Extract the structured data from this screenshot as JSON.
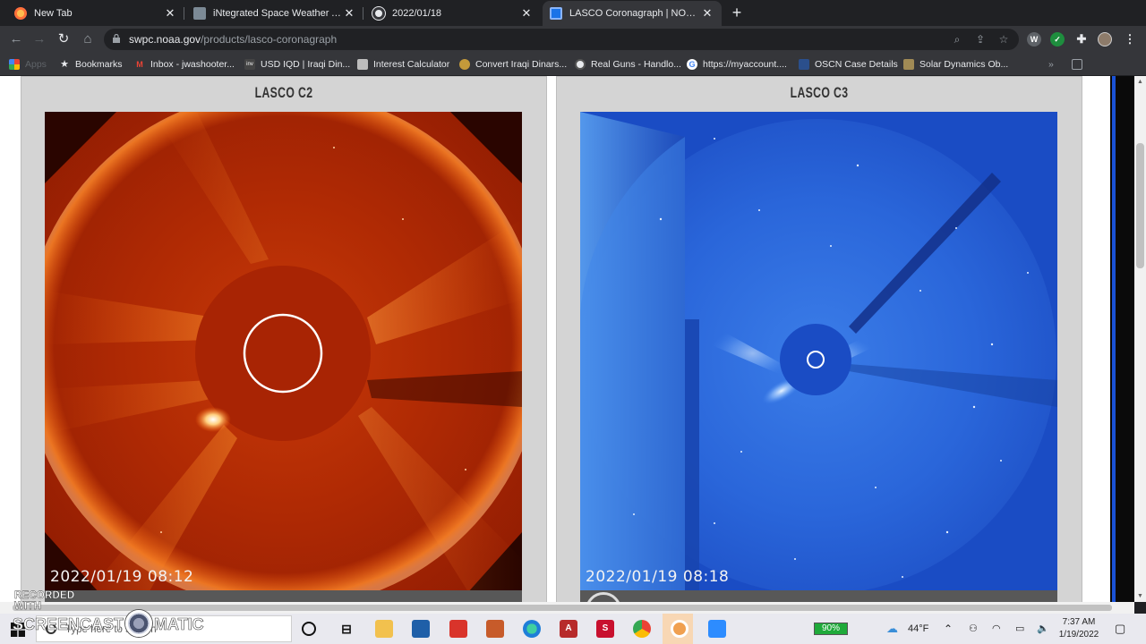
{
  "tabs": [
    {
      "label": "New Tab",
      "favicon": "firefox-icon",
      "active": false
    },
    {
      "label": "iNtegrated Space Weather Analy",
      "favicon": "satellite-icon",
      "active": false
    },
    {
      "label": "2022/01/18",
      "favicon": "globe-icon",
      "active": false
    },
    {
      "label": "LASCO Coronagraph | NOAA / NW",
      "favicon": "noaa-icon",
      "active": true
    }
  ],
  "toolbar": {
    "url_host": "swpc.noaa.gov",
    "url_path": "/products/lasco-coronagraph"
  },
  "bookmarks": {
    "apps_label": "Apps",
    "items": [
      {
        "label": "Bookmarks",
        "icon": "star-icon"
      },
      {
        "label": "Inbox - jwashooter...",
        "icon": "gmail-icon"
      },
      {
        "label": "USD IQD | Iraqi Din...",
        "icon": "inv-icon"
      },
      {
        "label": "Interest Calculator",
        "icon": "calculator-icon"
      },
      {
        "label": "Convert Iraqi Dinars...",
        "icon": "currency-icon"
      },
      {
        "label": "Real Guns - Handlo...",
        "icon": "target-icon"
      },
      {
        "label": "https://myaccount....",
        "icon": "google-icon"
      },
      {
        "label": "OSCN Case Details",
        "icon": "shield-icon"
      },
      {
        "label": "Solar Dynamics Ob...",
        "icon": "sdo-icon"
      }
    ]
  },
  "page": {
    "panels": [
      {
        "title": "LASCO C2",
        "timestamp": "2022/01/19 08:12"
      },
      {
        "title": "LASCO C3",
        "timestamp": "2022/01/19 08:18"
      }
    ]
  },
  "watermark": {
    "recorded": "RECORDED WITH",
    "brand_left": "SCREENCAST",
    "brand_right": "MATIC"
  },
  "taskbar": {
    "search_placeholder": "Type here to search",
    "battery": "90%",
    "weather": "44°F",
    "time": "7:37 AM",
    "date": "1/19/2022"
  }
}
